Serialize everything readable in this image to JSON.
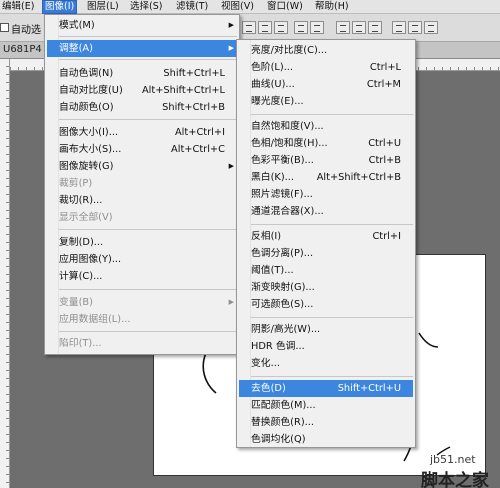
{
  "menubar": {
    "items": [
      {
        "label": "编辑(E)"
      },
      {
        "label": "图像(I)",
        "active": true
      },
      {
        "label": "图层(L)"
      },
      {
        "label": "选择(S)"
      },
      {
        "label": "滤镜(T)"
      },
      {
        "label": "视图(V)"
      },
      {
        "label": "窗口(W)"
      },
      {
        "label": "帮助(H)"
      }
    ]
  },
  "options": {
    "auto_select_label": "自动选"
  },
  "doc_tab": {
    "title": "U681P4"
  },
  "image_menu": {
    "items": [
      {
        "label": "模式(M)",
        "shortcut": "",
        "submenu": true
      },
      {
        "label": "调整(A)",
        "shortcut": "",
        "submenu": true,
        "highlighted": true
      },
      {
        "label": "自动色调(N)",
        "shortcut": "Shift+Ctrl+L"
      },
      {
        "label": "自动对比度(U)",
        "shortcut": "Alt+Shift+Ctrl+L"
      },
      {
        "label": "自动颜色(O)",
        "shortcut": "Shift+Ctrl+B"
      },
      {
        "label": "图像大小(I)...",
        "shortcut": "Alt+Ctrl+I"
      },
      {
        "label": "画布大小(S)...",
        "shortcut": "Alt+Ctrl+C"
      },
      {
        "label": "图像旋转(G)",
        "shortcut": "",
        "submenu": true
      },
      {
        "label": "裁剪(P)",
        "shortcut": "",
        "disabled": true
      },
      {
        "label": "裁切(R)...",
        "shortcut": ""
      },
      {
        "label": "显示全部(V)",
        "shortcut": "",
        "disabled": true
      },
      {
        "label": "复制(D)...",
        "shortcut": ""
      },
      {
        "label": "应用图像(Y)...",
        "shortcut": ""
      },
      {
        "label": "计算(C)...",
        "shortcut": ""
      },
      {
        "label": "变量(B)",
        "shortcut": "",
        "submenu": true,
        "disabled": true
      },
      {
        "label": "应用数据组(L)...",
        "shortcut": "",
        "disabled": true
      },
      {
        "label": "陷印(T)...",
        "shortcut": "",
        "disabled": true
      }
    ]
  },
  "adjust_menu": {
    "items": [
      {
        "label": "亮度/对比度(C)...",
        "shortcut": ""
      },
      {
        "label": "色阶(L)...",
        "shortcut": "Ctrl+L"
      },
      {
        "label": "曲线(U)...",
        "shortcut": "Ctrl+M"
      },
      {
        "label": "曝光度(E)...",
        "shortcut": ""
      },
      {
        "label": "自然饱和度(V)...",
        "shortcut": ""
      },
      {
        "label": "色相/饱和度(H)...",
        "shortcut": "Ctrl+U"
      },
      {
        "label": "色彩平衡(B)...",
        "shortcut": "Ctrl+B"
      },
      {
        "label": "黑白(K)...",
        "shortcut": "Alt+Shift+Ctrl+B"
      },
      {
        "label": "照片滤镜(F)...",
        "shortcut": ""
      },
      {
        "label": "通道混合器(X)...",
        "shortcut": ""
      },
      {
        "label": "反相(I)",
        "shortcut": "Ctrl+I"
      },
      {
        "label": "色调分离(P)...",
        "shortcut": ""
      },
      {
        "label": "阈值(T)...",
        "shortcut": ""
      },
      {
        "label": "渐变映射(G)...",
        "shortcut": ""
      },
      {
        "label": "可选颜色(S)...",
        "shortcut": ""
      },
      {
        "label": "阴影/高光(W)...",
        "shortcut": ""
      },
      {
        "label": "HDR 色调...",
        "shortcut": ""
      },
      {
        "label": "变化...",
        "shortcut": ""
      },
      {
        "label": "去色(D)",
        "shortcut": "Shift+Ctrl+U",
        "highlighted": true
      },
      {
        "label": "匹配颜色(M)...",
        "shortcut": ""
      },
      {
        "label": "替换颜色(R)...",
        "shortcut": ""
      },
      {
        "label": "色调均化(Q)",
        "shortcut": ""
      }
    ]
  },
  "watermark": {
    "line1": "jb51.net",
    "line2": "脚本之家"
  },
  "colors": {
    "highlight": "#3c86e0",
    "menubar_active": "#3a7bd5"
  }
}
